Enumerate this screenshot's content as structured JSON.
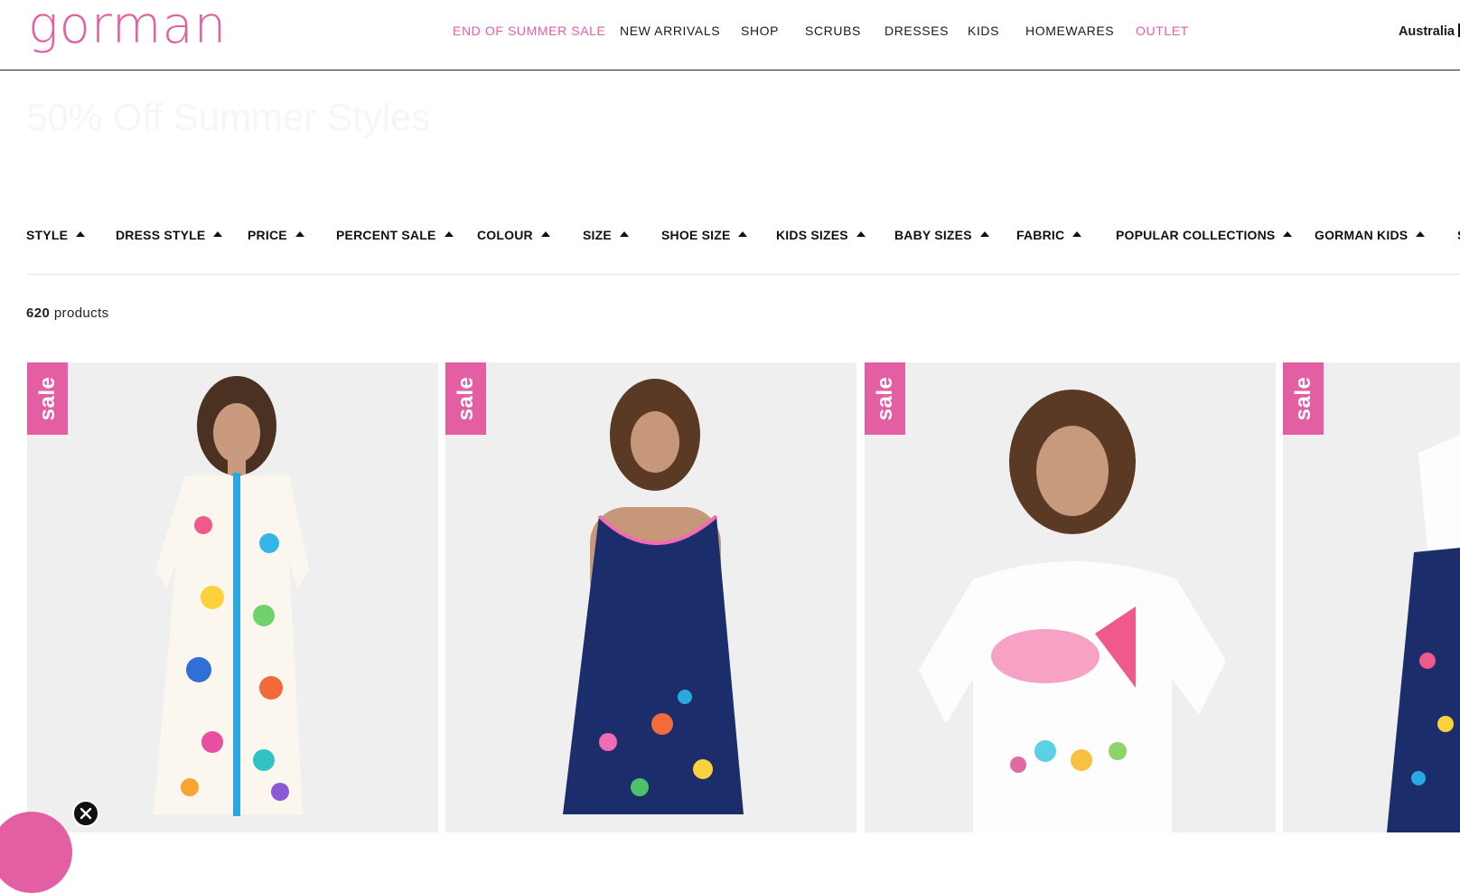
{
  "brand": {
    "name": "gorman",
    "accent": "#e45ea3"
  },
  "nav": {
    "items": [
      {
        "label": "END OF SUMMER SALE",
        "color": "#e45ea3"
      },
      {
        "label": "NEW ARRIVALS",
        "color": "#1a1a1a"
      },
      {
        "label": "SHOP",
        "color": "#1a1a1a"
      },
      {
        "label": "SCRUBS",
        "color": "#1a1a1a"
      },
      {
        "label": "DRESSES",
        "color": "#1a1a1a"
      },
      {
        "label": "KIDS",
        "color": "#1a1a1a"
      },
      {
        "label": "HOMEWARES",
        "color": "#1a1a1a"
      },
      {
        "label": "OUTLET",
        "color": "#e45ea3"
      }
    ],
    "region": "Australia"
  },
  "hero": {
    "title": "50% Off Summer Styles",
    "color": "#f6f6f6"
  },
  "filters": [
    "STYLE",
    "DRESS STYLE",
    "PRICE",
    "PERCENT SALE",
    "COLOUR",
    "SIZE",
    "SHOE SIZE",
    "KIDS SIZES",
    "BABY SIZES",
    "FABRIC",
    "POPULAR COLLECTIONS",
    "GORMAN KIDS",
    "S"
  ],
  "results": {
    "count": "620",
    "label": "products"
  },
  "products": [
    {
      "badge": "sale",
      "image": "model-in-white-ocean-print-shirt-dress"
    },
    {
      "badge": "sale",
      "image": "model-in-navy-coral-reef-sleeveless-dress"
    },
    {
      "badge": "sale",
      "image": "model-in-white-fish-embellished-tee"
    },
    {
      "badge": "sale",
      "image": "model-in-navy-print-skirt"
    }
  ],
  "promo": {
    "close_icon": "close-icon"
  }
}
